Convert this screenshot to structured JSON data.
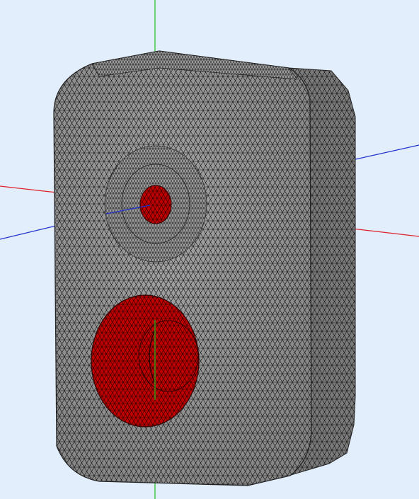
{
  "viewport": {
    "background": "#e2eefb"
  },
  "model": {
    "body_color": "#8f8f8f",
    "side_color": "#7a7a7a",
    "mesh_color": "#111111",
    "highlight_color": "#c00000"
  },
  "axes": {
    "x_color": "#e0202a",
    "y_color": "#1fbf1f",
    "z_color": "#2030d0"
  }
}
